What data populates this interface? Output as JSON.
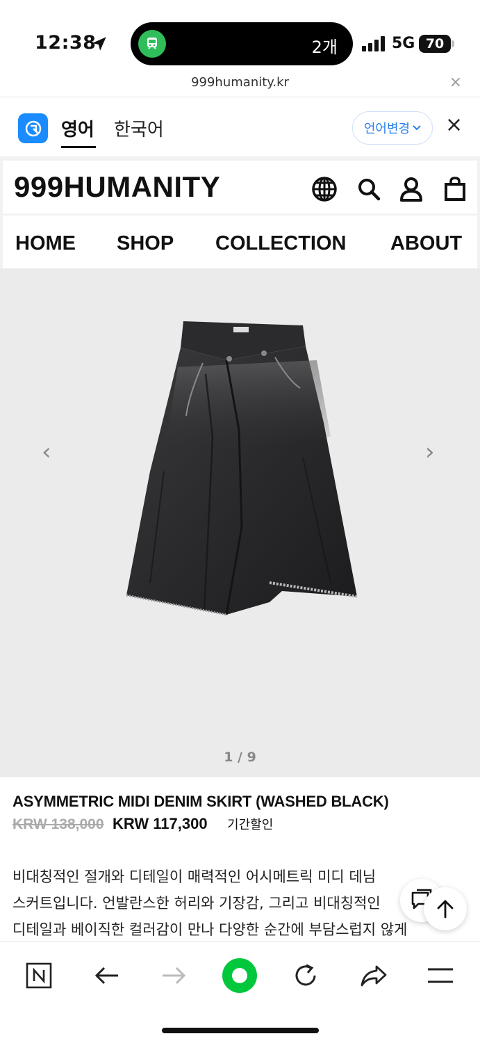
{
  "status_bar": {
    "time": "12:38",
    "island_count": "2개",
    "network": "5G",
    "battery": "70"
  },
  "browser": {
    "url": "999humanity.kr",
    "close_symbol": "×"
  },
  "translate_bar": {
    "lang_en": "영어",
    "lang_ko": "한국어",
    "change_label": "언어변경",
    "close_symbol": "×"
  },
  "site": {
    "logo": "999HUMANITY",
    "nav": [
      {
        "label": "HOME"
      },
      {
        "label": "SHOP"
      },
      {
        "label": "COLLECTION"
      },
      {
        "label": "ABOUT"
      }
    ],
    "header_icons": [
      "globe-icon",
      "search-icon",
      "account-icon",
      "cart-icon"
    ]
  },
  "gallery": {
    "counter": "1 / 9",
    "prev_symbol": "‹",
    "next_symbol": "›"
  },
  "product": {
    "title": "ASYMMETRIC MIDI DENIM SKIRT (WASHED BLACK)",
    "price_original": "KRW 138,000",
    "price_sale": "KRW 117,300",
    "badge": "기간할인",
    "description": [
      "비대칭적인 절개와 디테일이 매력적인 어시메트릭 미디 데님",
      "스커트입니다. 언발란스한 허리와 기장감, 그리고 비대칭적인",
      "디테일과 베이직한 컬러감이 만나 다양한 순간에 부담스럽지 않게"
    ]
  },
  "toolbar": {
    "items": [
      "naver-home-icon",
      "back-icon",
      "forward-icon",
      "green-dot-icon",
      "reload-icon",
      "share-icon",
      "menu-icon"
    ]
  },
  "colors": {
    "accent_blue": "#1a8cff",
    "green": "#00c73c",
    "text": "#111111",
    "gallery_bg": "#ebebeb"
  }
}
